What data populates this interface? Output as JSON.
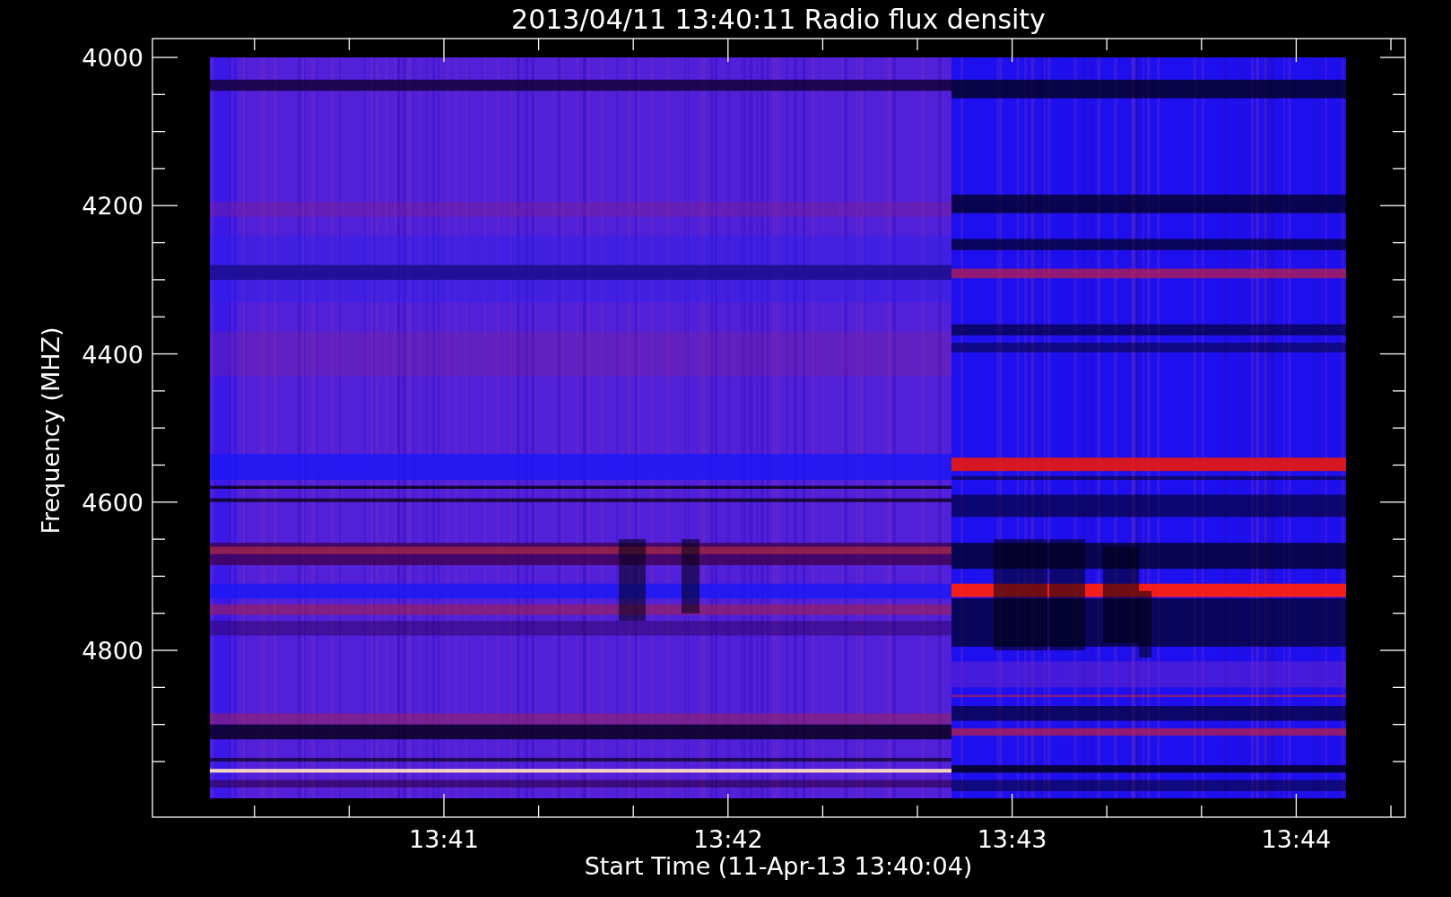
{
  "title": "2013/04/11 13:40:11 Radio flux density",
  "y_axis": {
    "label": "Frequency (MHZ)",
    "ticks": [
      "4000",
      "4200",
      "4400",
      "4600",
      "4800"
    ]
  },
  "x_axis": {
    "label": "Start Time (11-Apr-13 13:40:04)",
    "ticks": [
      "13:41",
      "13:42",
      "13:43",
      "13:44"
    ]
  }
}
